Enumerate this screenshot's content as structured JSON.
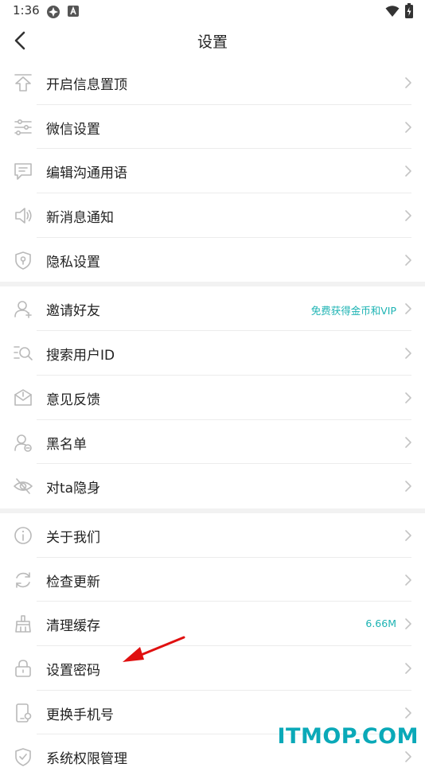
{
  "status_bar": {
    "time": "1:36"
  },
  "header": {
    "title": "设置"
  },
  "groups": [
    [
      {
        "name": "pin-messages",
        "label": "开启信息置顶",
        "icon": "pin-top-icon"
      },
      {
        "name": "wechat-settings",
        "label": "微信设置",
        "icon": "sliders-icon"
      },
      {
        "name": "edit-phrases",
        "label": "编辑沟通用语",
        "icon": "chat-icon"
      },
      {
        "name": "new-message-notify",
        "label": "新消息通知",
        "icon": "speaker-icon"
      },
      {
        "name": "privacy-settings",
        "label": "隐私设置",
        "icon": "shield-icon"
      }
    ],
    [
      {
        "name": "invite-friends",
        "label": "邀请好友",
        "value": "免费获得金币和VIP",
        "icon": "user-add-icon"
      },
      {
        "name": "search-user-id",
        "label": "搜索用户ID",
        "icon": "search-list-icon"
      },
      {
        "name": "feedback",
        "label": "意见反馈",
        "icon": "feedback-icon"
      },
      {
        "name": "blacklist",
        "label": "黑名单",
        "icon": "user-block-icon"
      },
      {
        "name": "hide-from",
        "label": "对ta隐身",
        "icon": "eye-off-icon"
      }
    ],
    [
      {
        "name": "about-us",
        "label": "关于我们",
        "icon": "info-icon"
      },
      {
        "name": "check-update",
        "label": "检查更新",
        "icon": "refresh-icon"
      },
      {
        "name": "clear-cache",
        "label": "清理缓存",
        "value": "6.66M",
        "icon": "broom-icon"
      },
      {
        "name": "set-password",
        "label": "设置密码",
        "icon": "lock-icon"
      },
      {
        "name": "change-phone",
        "label": "更换手机号",
        "icon": "phone-icon"
      },
      {
        "name": "system-permissions",
        "label": "系统权限管理",
        "icon": "permission-icon"
      }
    ]
  ],
  "watermark": "ITMOP.COM",
  "colors": {
    "accent": "#1cb3b3",
    "watermark": "#0aa9b8",
    "annotation_arrow": "#e01010"
  }
}
